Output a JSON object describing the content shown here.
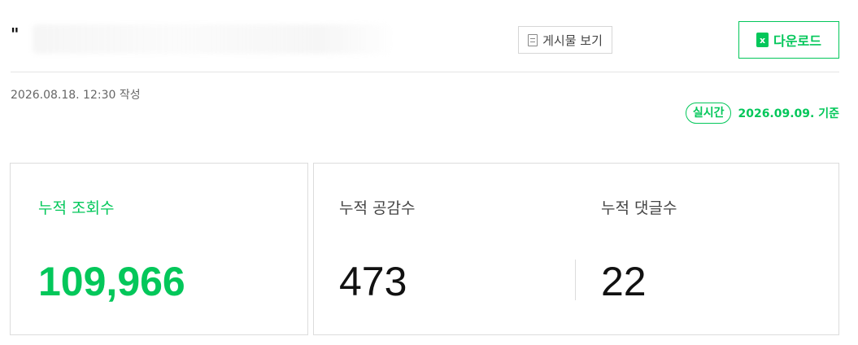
{
  "header": {
    "title": "\"",
    "view_post_label": "게시물 보기",
    "download_label": "다운로드",
    "download_icon_text": "x"
  },
  "meta": {
    "written_date": "2026.08.18. 12:30 작성",
    "realtime_badge": "실시간",
    "realtime_date": "2026.09.09. 기준"
  },
  "stats": {
    "views": {
      "label": "누적 조회수",
      "value": "109,966"
    },
    "likes": {
      "label": "누적 공감수",
      "value": "473"
    },
    "comments": {
      "label": "누적 댓글수",
      "value": "22"
    }
  },
  "colors": {
    "accent": "#03c75a",
    "border": "#dcdcdc",
    "text": "#111111"
  },
  "icons": {
    "view_post": "document-icon",
    "download": "excel-icon"
  }
}
